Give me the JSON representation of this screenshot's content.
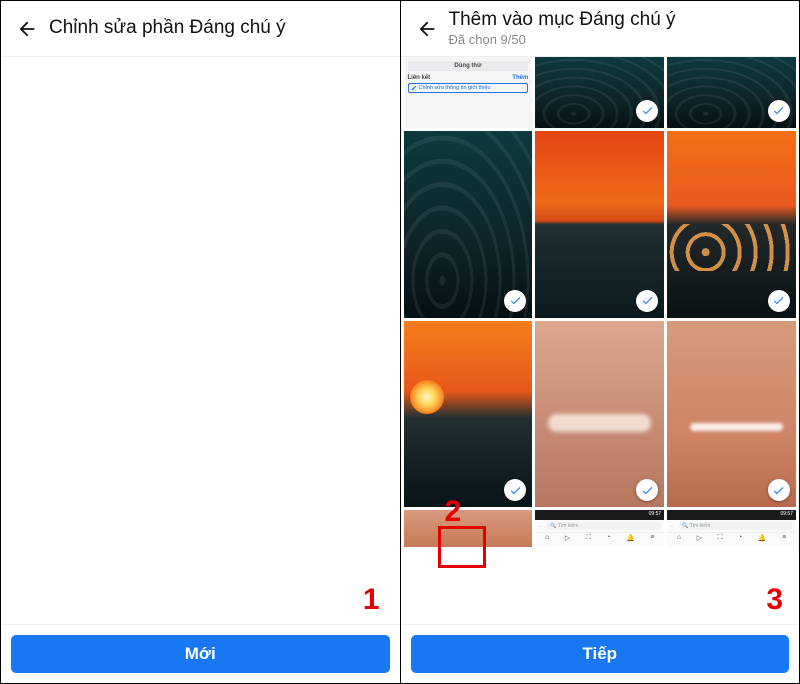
{
  "left": {
    "title": "Chỉnh sửa phần Đáng chú ý",
    "button": "Mới",
    "annotation": "1"
  },
  "right": {
    "title": "Thêm vào mục Đáng chú ý",
    "subtitle": "Đã chọn 9/50",
    "button": "Tiếp",
    "screenshot_card": {
      "try_button": "Dùng thử",
      "section_label": "Liên kết",
      "add_link": "Thêm",
      "edit_bio": "Chỉnh sửa thông tin giới thiệu"
    },
    "browser_card": {
      "search_placeholder": "Tìm kiếm",
      "time": "09:57"
    },
    "annotations": {
      "two": "2",
      "three": "3"
    }
  }
}
